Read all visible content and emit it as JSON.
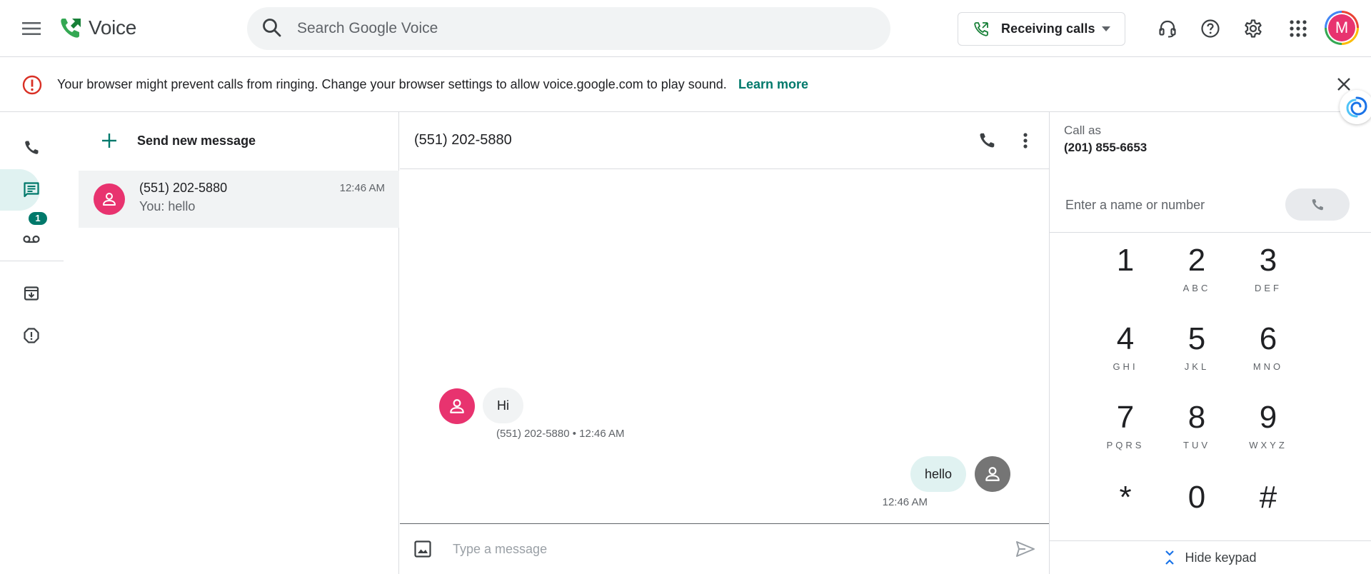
{
  "header": {
    "app_name": "Voice",
    "search_placeholder": "Search Google Voice",
    "receiving_calls_label": "Receiving calls",
    "avatar_initial": "M"
  },
  "banner": {
    "message": "Your browser might prevent calls from ringing. Change your browser settings to allow voice.google.com to play sound.",
    "link_label": "Learn more"
  },
  "rail": {
    "voicemail_badge": "1"
  },
  "list": {
    "new_message_label": "Send new message",
    "conversations": [
      {
        "name": "(551) 202-5880",
        "snippet": "You: hello",
        "time": "12:46 AM"
      }
    ]
  },
  "thread": {
    "title": "(551) 202-5880",
    "messages": [
      {
        "text": "Hi",
        "meta": "(551) 202-5880 • 12:46 AM",
        "direction": "incoming"
      },
      {
        "text": "hello",
        "meta": "12:46 AM",
        "direction": "outgoing"
      }
    ],
    "composer_placeholder": "Type a message"
  },
  "dialer": {
    "call_as_label": "Call as",
    "call_as_number": "(201) 855-6653",
    "input_placeholder": "Enter a name or number",
    "keys": [
      {
        "digit": "1",
        "letters": ""
      },
      {
        "digit": "2",
        "letters": "ABC"
      },
      {
        "digit": "3",
        "letters": "DEF"
      },
      {
        "digit": "4",
        "letters": "GHI"
      },
      {
        "digit": "5",
        "letters": "JKL"
      },
      {
        "digit": "6",
        "letters": "MNO"
      },
      {
        "digit": "7",
        "letters": "PQRS"
      },
      {
        "digit": "8",
        "letters": "TUV"
      },
      {
        "digit": "9",
        "letters": "WXYZ"
      },
      {
        "digit": "*",
        "letters": ""
      },
      {
        "digit": "0",
        "letters": ""
      },
      {
        "digit": "#",
        "letters": ""
      }
    ],
    "hide_keypad_label": "Hide keypad"
  },
  "colors": {
    "accent": "#00796b",
    "avatar_pink": "#e8336f",
    "active_tint": "#e0f2f1",
    "warning_red": "#d93025"
  }
}
